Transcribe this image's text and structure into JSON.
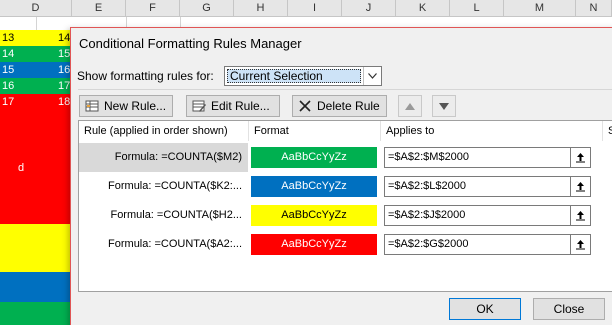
{
  "spreadsheet": {
    "columns": [
      "D",
      "E",
      "F",
      "G",
      "H",
      "I",
      "J",
      "K",
      "L",
      "M",
      "N"
    ],
    "rows": [
      {
        "col_a": "13",
        "col_b": "14",
        "color": "#ffff00",
        "text_color": "#000000"
      },
      {
        "col_a": "14",
        "col_b": "15",
        "color": "#00b050",
        "text_color": "#ffffff"
      },
      {
        "col_a": "15",
        "col_b": "16",
        "color": "#0070c0",
        "text_color": "#ffffff"
      },
      {
        "col_a": "16",
        "col_b": "17",
        "color": "#00b050",
        "text_color": "#ffffff"
      },
      {
        "col_a": "17",
        "col_b": "18",
        "color": "#ff0000",
        "text_color": "#ffffff"
      }
    ],
    "cell_d_text": "d",
    "bands": [
      {
        "color": "#ff0000"
      },
      {
        "color": "#ffff00"
      },
      {
        "color": "#0070c0"
      },
      {
        "color": "#00b050"
      }
    ]
  },
  "dialog": {
    "title": "Conditional Formatting Rules Manager",
    "show_rules_label": "Show formatting rules for:",
    "show_rules_value": "Current Selection",
    "toolbar": {
      "new_rule": "New Rule...",
      "edit_rule": "Edit Rule...",
      "delete_rule": "Delete Rule"
    },
    "table": {
      "headers": [
        "Rule (applied in order shown)",
        "Format",
        "Applies to",
        "S"
      ],
      "rows": [
        {
          "rule": "Formula: =COUNTA($M2)",
          "format_sample": "AaBbCcYyZz",
          "format_bg": "#00b050",
          "format_fg": "#ffffff",
          "applies_to": "=$A$2:$M$2000"
        },
        {
          "rule": "Formula: =COUNTA($K2:...",
          "format_sample": "AaBbCcYyZz",
          "format_bg": "#0070c0",
          "format_fg": "#ffffff",
          "applies_to": "=$A$2:$L$2000"
        },
        {
          "rule": "Formula: =COUNTA($H2...",
          "format_sample": "AaBbCcYyZz",
          "format_bg": "#ffff00",
          "format_fg": "#000000",
          "applies_to": "=$A$2:$J$2000"
        },
        {
          "rule": "Formula: =COUNTA($A2:...",
          "format_sample": "AaBbCcYyZz",
          "format_bg": "#ff0000",
          "format_fg": "#ffffff",
          "applies_to": "=$A$2:$G$2000"
        }
      ]
    },
    "ok_label": "OK",
    "close_label": "Close"
  }
}
